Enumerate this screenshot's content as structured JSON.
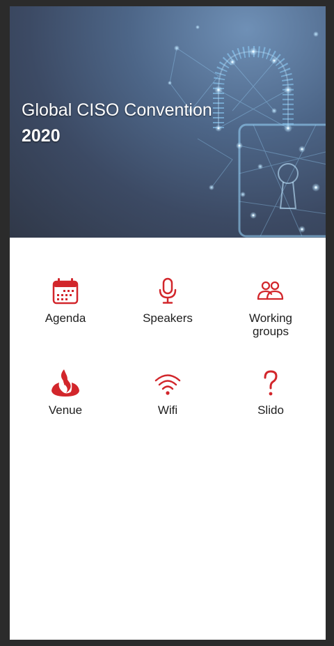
{
  "hero": {
    "title": "Global CISO Convention",
    "year": "2020"
  },
  "menu": {
    "accent_color": "#d2262b",
    "items": [
      {
        "label": "Agenda",
        "icon": "calendar-icon"
      },
      {
        "label": "Speakers",
        "icon": "microphone-icon"
      },
      {
        "label": "Working groups",
        "icon": "people-icon"
      },
      {
        "label": "Venue",
        "icon": "santander-flame-icon"
      },
      {
        "label": "Wifi",
        "icon": "wifi-icon"
      },
      {
        "label": "Slido",
        "icon": "question-mark-icon"
      }
    ]
  }
}
